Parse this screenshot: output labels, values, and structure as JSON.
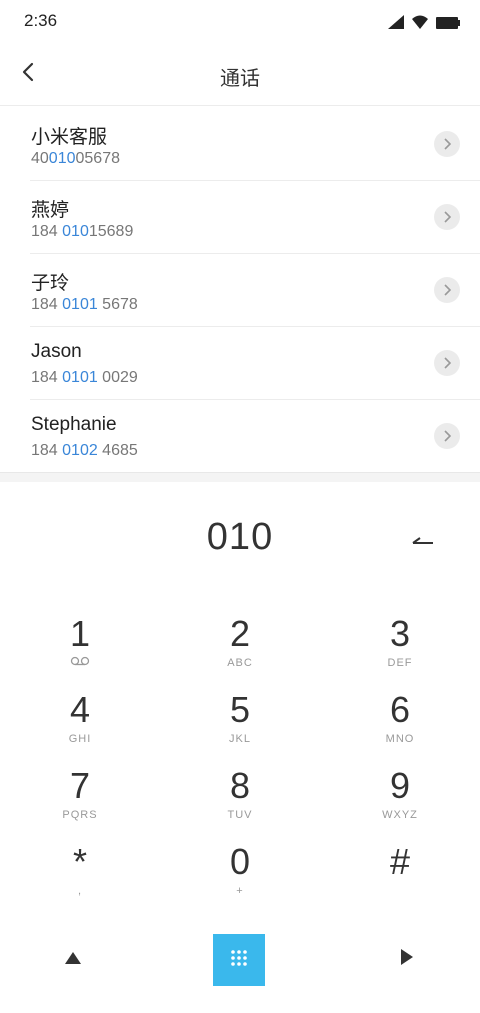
{
  "status_bar": {
    "time": "2:36",
    "icons": [
      "signal-icon",
      "wifi-icon",
      "battery-icon"
    ]
  },
  "header": {
    "title": "通话",
    "back_icon": "back-arrow-icon"
  },
  "contacts": [
    {
      "name": "小米客服",
      "number_parts": [
        "40",
        "010",
        "05678"
      ]
    },
    {
      "name": "燕婷",
      "number_parts": [
        "184 ",
        "010",
        "15689"
      ]
    },
    {
      "name": "子玲",
      "number_parts": [
        "184 ",
        "0101",
        " 5678"
      ]
    },
    {
      "name": "Jason",
      "number_parts": [
        "184 ",
        "0101",
        " 0029"
      ]
    },
    {
      "name": "Stephanie",
      "number_parts": [
        "184 ",
        "0102",
        " 4685"
      ]
    }
  ],
  "dialer": {
    "input_value": "010",
    "backspace_icon": "backspace-icon"
  },
  "keypad": {
    "keys": [
      {
        "digit": "1",
        "letters": ""
      },
      {
        "digit": "2",
        "letters": "ABC"
      },
      {
        "digit": "3",
        "letters": "DEF"
      },
      {
        "digit": "4",
        "letters": "GHI"
      },
      {
        "digit": "5",
        "letters": "JKL"
      },
      {
        "digit": "6",
        "letters": "MNO"
      },
      {
        "digit": "7",
        "letters": "PQRS"
      },
      {
        "digit": "8",
        "letters": "TUV"
      },
      {
        "digit": "9",
        "letters": "WXYZ"
      },
      {
        "digit": "*",
        "letters": ","
      },
      {
        "digit": "0",
        "letters": "+"
      },
      {
        "digit": "#",
        "letters": ""
      }
    ]
  },
  "bottom_bar": {
    "left_icon": "collapse-triangle-icon",
    "center_icon": "dialpad-grid-icon",
    "right_icon": "play-triangle-icon"
  },
  "colors": {
    "highlight": "#3a86d8",
    "accent": "#3ab8ec"
  }
}
